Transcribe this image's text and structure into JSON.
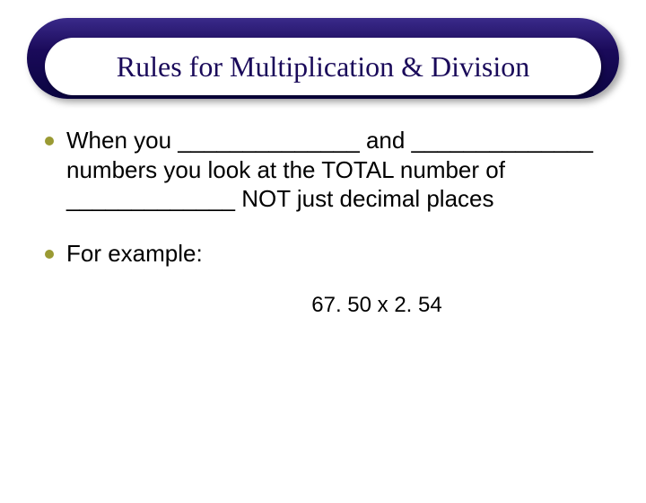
{
  "title": "Rules for Multiplication & Division",
  "bullets": [
    {
      "text": "When you ______________ and ______________ numbers you look at the TOTAL number of _____________ NOT just decimal places"
    },
    {
      "text": "For example:"
    }
  ],
  "example": "67. 50  x  2. 54"
}
